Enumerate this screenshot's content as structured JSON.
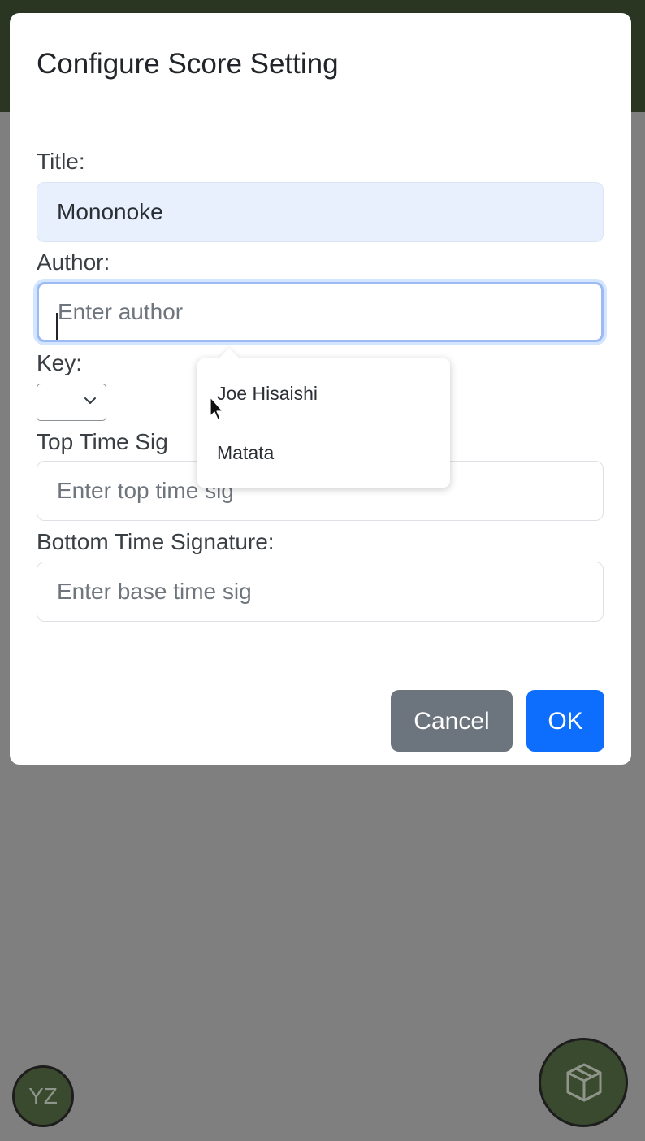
{
  "modal": {
    "title": "Configure Score Setting",
    "fields": {
      "title": {
        "label": "Title:",
        "value": "Mononoke",
        "placeholder": ""
      },
      "author": {
        "label": "Author:",
        "value": "",
        "placeholder": "Enter author"
      },
      "key": {
        "label": "Key:",
        "value": ""
      },
      "top_time_sig": {
        "label": "Top Time Sig",
        "value": "",
        "placeholder": "Enter top time sig"
      },
      "bottom_time_sig": {
        "label": "Bottom Time Signature:",
        "value": "",
        "placeholder": "Enter base time sig"
      }
    },
    "buttons": {
      "cancel": "Cancel",
      "ok": "OK"
    }
  },
  "autocomplete": {
    "items": [
      "Joe Hisaishi",
      "Matata"
    ]
  },
  "avatar": {
    "initials": "YZ"
  },
  "fab": {
    "icon": "cube-icon"
  },
  "colors": {
    "header_bg": "#2a3622",
    "overlay_bg": "#7f7f7f",
    "primary": "#0d6efd",
    "secondary": "#6c757d",
    "title_field_bg": "#e8effd",
    "avatar_bg": "#3a4a2e"
  }
}
